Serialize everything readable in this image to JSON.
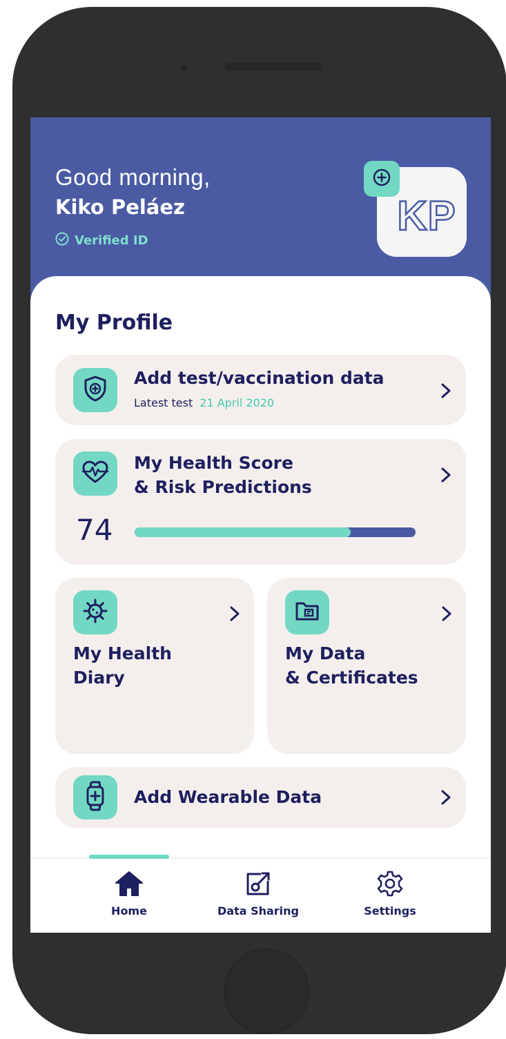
{
  "header": {
    "greeting": "Good morning,",
    "user_name": "Kiko Peláez",
    "verified_label": "Verified ID",
    "avatar_initials": "KP"
  },
  "profile": {
    "title": "My Profile",
    "test_card": {
      "title": "Add test/vaccination data",
      "latest_label": "Latest test",
      "latest_date": "21 April 2020"
    },
    "health_score_card": {
      "title_line1": "My Health Score",
      "title_line2": "& Risk Predictions",
      "score": "74",
      "progress_fraction": 0.77
    },
    "diary_card": {
      "title_line1": "My Health",
      "title_line2": "Diary"
    },
    "data_card": {
      "title_line1": "My Data",
      "title_line2": "& Certificates"
    },
    "wearable_card": {
      "title": "Add Wearable Data"
    }
  },
  "nav": {
    "items": [
      {
        "label": "Home",
        "icon": "home-icon",
        "active": true
      },
      {
        "label": "Data Sharing",
        "icon": "share-icon",
        "active": false
      },
      {
        "label": "Settings",
        "icon": "gear-icon",
        "active": false
      }
    ]
  },
  "colors": {
    "header_bg": "#4a5ba3",
    "accent_teal": "#72d8c4",
    "navy_text": "#1e1f5f",
    "tile_bg": "#f4efed"
  }
}
